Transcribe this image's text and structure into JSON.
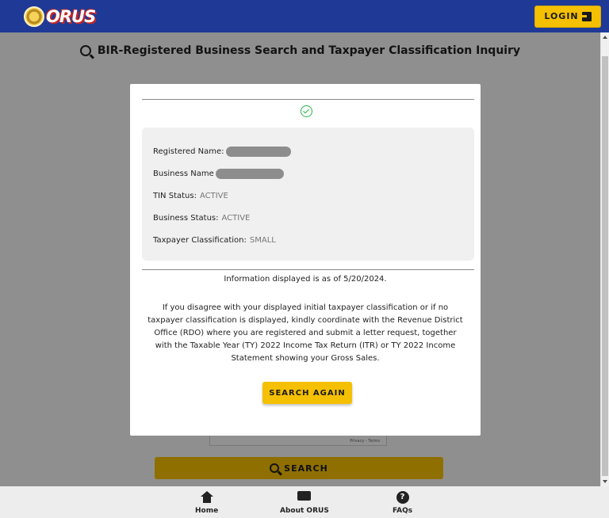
{
  "header": {
    "logo_text": "ORUS",
    "login_label": "LOGIN"
  },
  "page": {
    "title": "BIR-Registered Business Search and Taxpayer Classification Inquiry",
    "captcha_footer": "Privacy - Terms",
    "search_label": "SEARCH"
  },
  "bottom_nav": {
    "home": "Home",
    "about": "About ORUS",
    "faqs": "FAQs"
  },
  "modal": {
    "fields": {
      "registered_name_label": "Registered Name:",
      "business_name_label": "Business Name",
      "tin_status_label": "TIN Status:",
      "tin_status_value": "ACTIVE",
      "business_status_label": "Business Status:",
      "business_status_value": "ACTIVE",
      "classification_label": "Taxpayer Classification:",
      "classification_value": "SMALL"
    },
    "as_of": "Information displayed is as of 5/20/2024.",
    "message": "If you disagree with your displayed initial taxpayer classification or if no taxpayer classification is displayed, kindly coordinate with the Revenue District Office (RDO) where you are registered and submit a letter request, together with the Taxable Year (TY) 2022 Income Tax Return (ITR) or TY 2022 Income Statement showing your Gross Sales.",
    "search_again_label": "SEARCH AGAIN"
  },
  "colors": {
    "header_bg": "#1f3a96",
    "accent": "#f5c000",
    "success": "#2bb24c"
  }
}
